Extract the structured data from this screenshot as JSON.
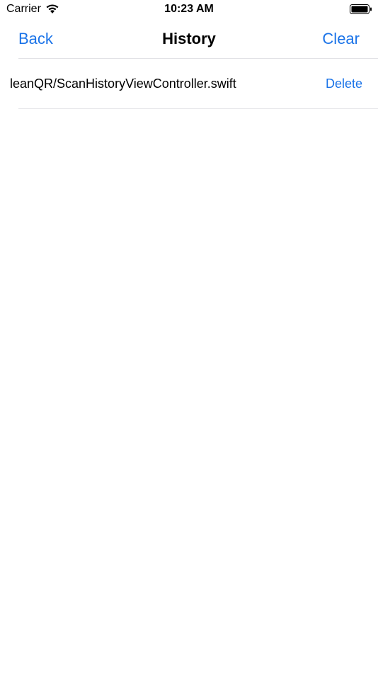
{
  "status_bar": {
    "carrier": "Carrier",
    "time": "10:23 AM",
    "wifi_icon": "wifi-icon",
    "battery_icon": "battery-icon"
  },
  "nav": {
    "back_label": "Back",
    "title": "History",
    "clear_label": "Clear"
  },
  "history": {
    "items": [
      {
        "text": "leanQR/ScanHistoryViewController.swift",
        "delete_label": "Delete"
      }
    ]
  },
  "colors": {
    "accent": "#1a73e8",
    "separator": "#e2e2e6",
    "background": "#ffffff"
  }
}
